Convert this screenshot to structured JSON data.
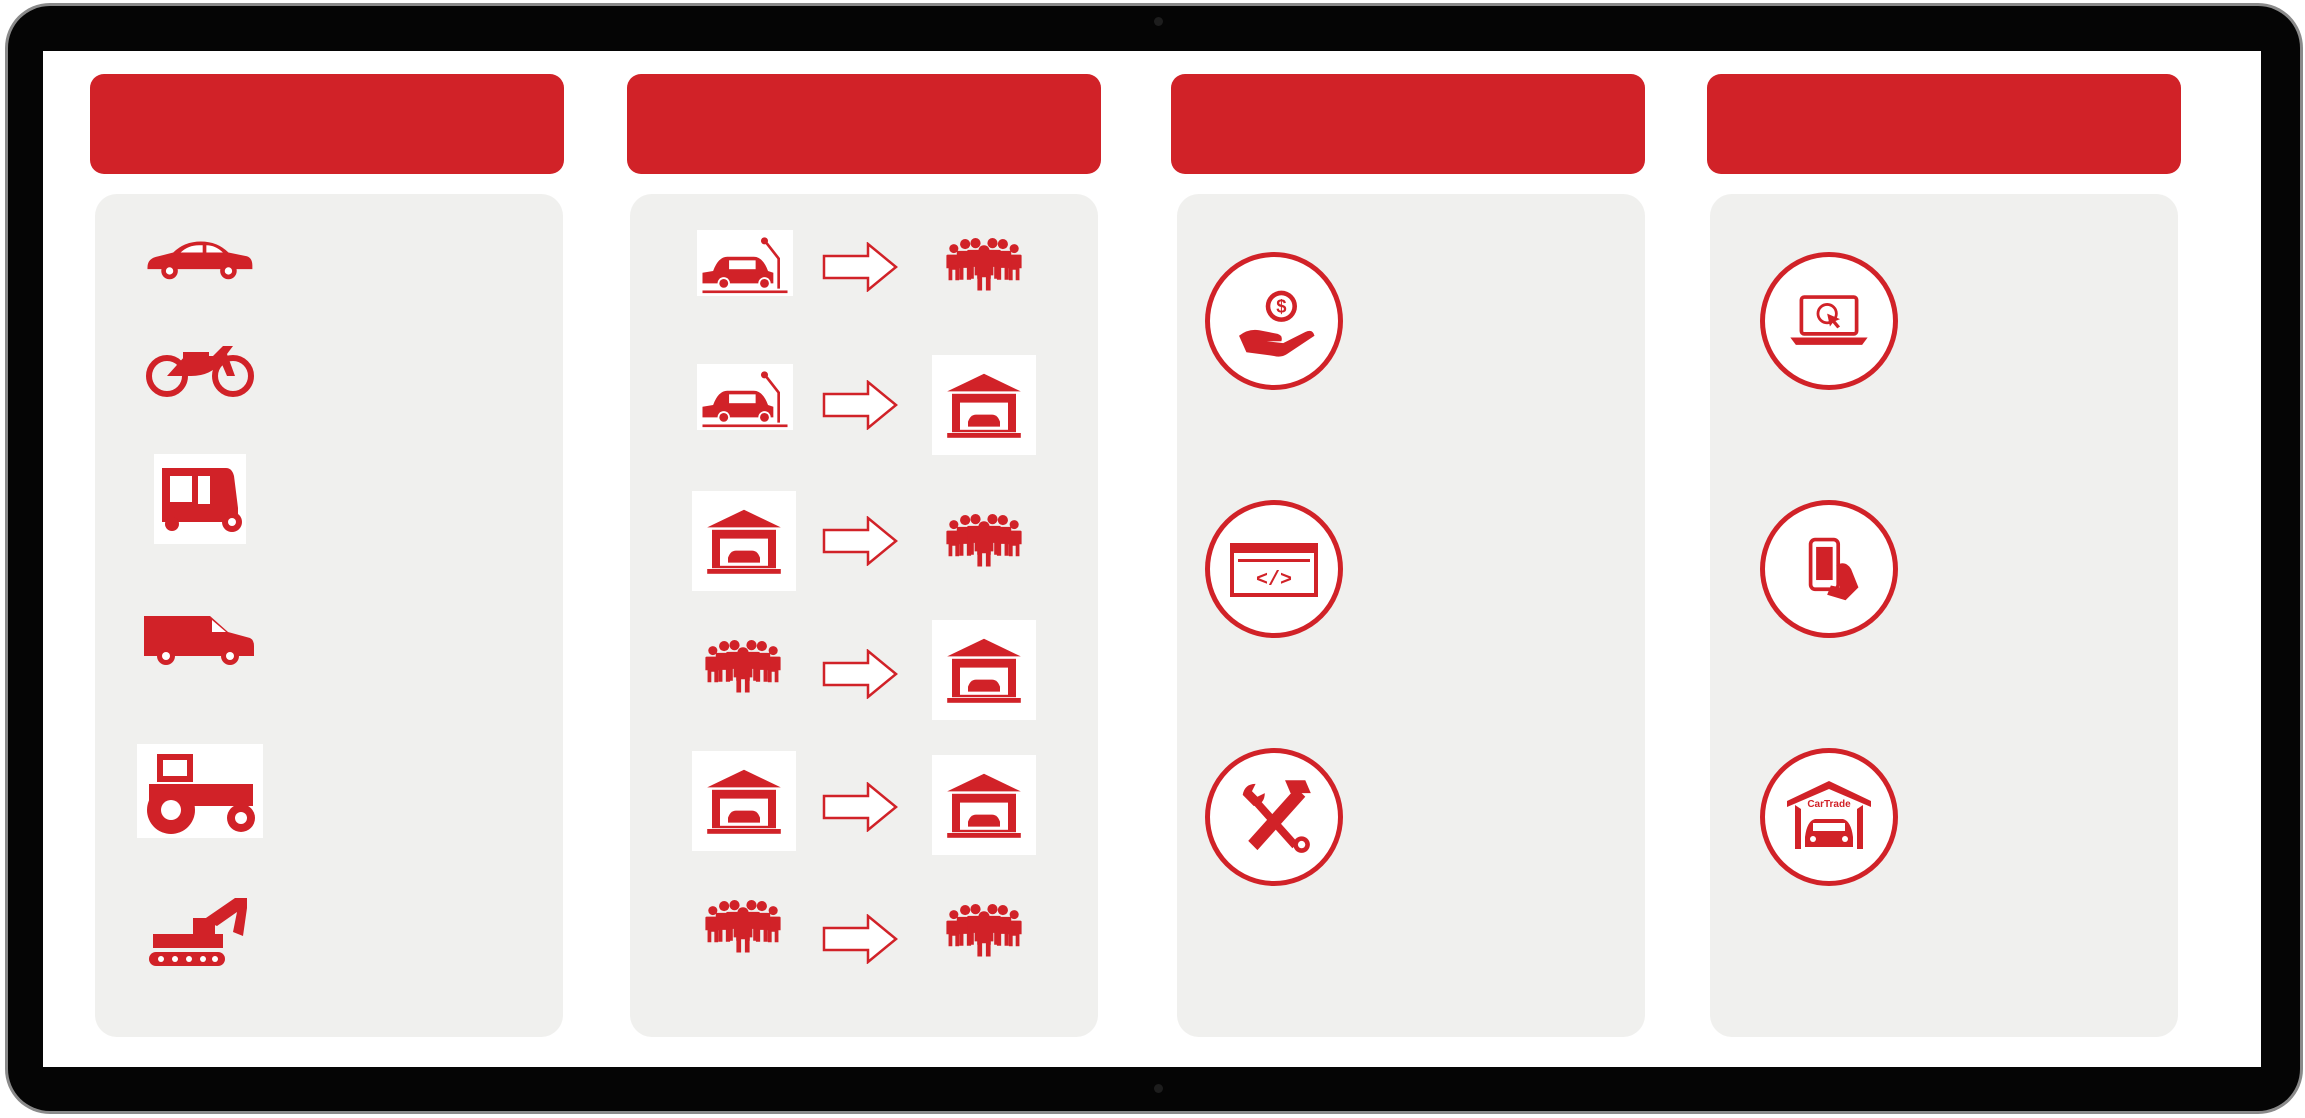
{
  "theme": {
    "accent": "#d12228",
    "panel_bg": "#f0f0ee",
    "bezel": "#050505"
  },
  "columns": [
    {
      "header": "",
      "items": [
        {
          "icon": "car-icon"
        },
        {
          "icon": "motorcycle-icon"
        },
        {
          "icon": "auto-rickshaw-icon"
        },
        {
          "icon": "van-icon"
        },
        {
          "icon": "tractor-icon"
        },
        {
          "icon": "excavator-icon"
        }
      ]
    },
    {
      "header": "",
      "flows": [
        {
          "from": "manufacturer-icon",
          "to": "people-group-icon"
        },
        {
          "from": "manufacturer-icon",
          "to": "dealership-garage-icon"
        },
        {
          "from": "dealership-garage-icon",
          "to": "people-group-icon"
        },
        {
          "from": "people-group-icon",
          "to": "dealership-garage-icon"
        },
        {
          "from": "dealership-garage-icon",
          "to": "dealership-garage-icon"
        },
        {
          "from": "people-group-icon",
          "to": "people-group-icon"
        }
      ]
    },
    {
      "header": "",
      "items": [
        {
          "icon": "money-hand-icon"
        },
        {
          "icon": "code-window-icon"
        },
        {
          "icon": "wrench-hammer-icon"
        }
      ]
    },
    {
      "header": "",
      "items": [
        {
          "icon": "laptop-click-icon"
        },
        {
          "icon": "mobile-hand-icon"
        },
        {
          "icon": "car-garage-brand-icon",
          "brand_text": "CarTrade"
        }
      ]
    }
  ]
}
